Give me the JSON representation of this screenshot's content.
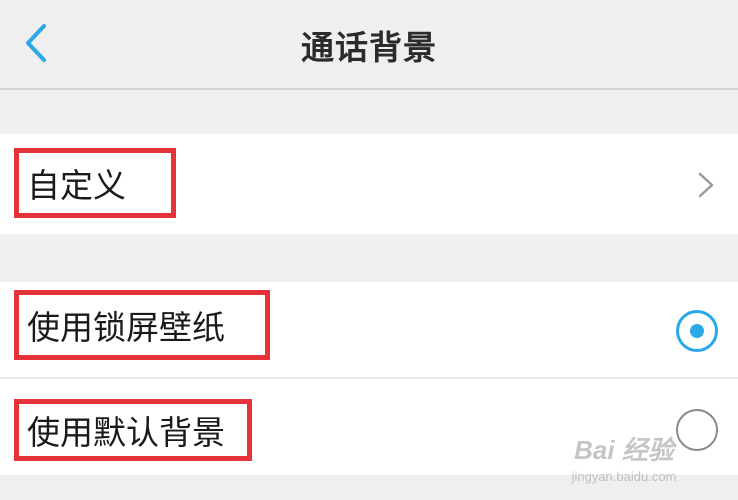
{
  "header": {
    "title": "通话背景",
    "back_icon": "chevron-left-icon"
  },
  "options": {
    "custom": {
      "label": "自定义",
      "icon": "chevron-right-icon"
    },
    "lock_wallpaper": {
      "label": "使用锁屏壁纸",
      "selected": true
    },
    "default_background": {
      "label": "使用默认背景",
      "selected": false
    }
  },
  "colors": {
    "accent": "#2aa8e8",
    "highlight_box": "#e53238",
    "background": "#efefef",
    "row": "#ffffff"
  },
  "watermark": {
    "brand": "Bai 经验",
    "url": "jingyan.baidu.com"
  }
}
